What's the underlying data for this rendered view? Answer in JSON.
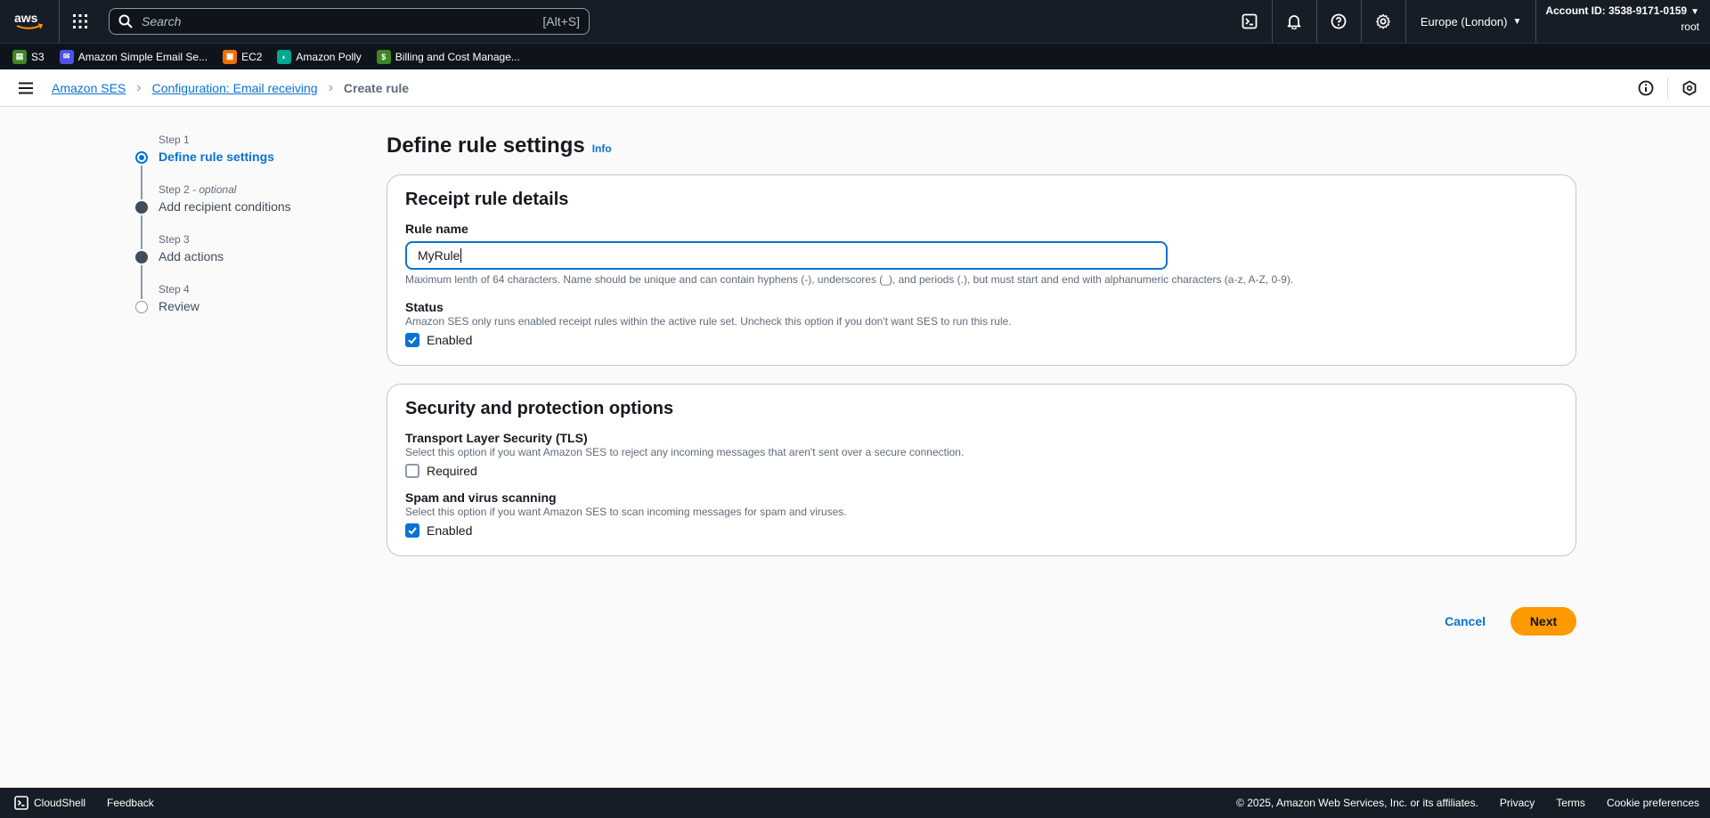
{
  "topnav": {
    "logo_text": "aws",
    "search_placeholder": "Search",
    "search_shortcut": "[Alt+S]",
    "region": "Europe (London)",
    "account_id": "Account ID: 3538-9171-0159",
    "user": "root"
  },
  "favorites": [
    {
      "label": "S3",
      "color": "#3f8624",
      "icon": "s3-icon"
    },
    {
      "label": "Amazon Simple Email Se...",
      "color": "#4d52e6",
      "icon": "ses-icon"
    },
    {
      "label": "EC2",
      "color": "#ed7100",
      "icon": "ec2-icon"
    },
    {
      "label": "Amazon Polly",
      "color": "#01a88d",
      "icon": "polly-icon"
    },
    {
      "label": "Billing and Cost Manage...",
      "color": "#3f8624",
      "icon": "billing-icon"
    }
  ],
  "breadcrumb": {
    "items": [
      "Amazon SES",
      "Configuration: Email receiving"
    ],
    "current": "Create rule"
  },
  "steps": [
    {
      "num": "Step 1",
      "optional": "",
      "label": "Define rule settings",
      "state": "active"
    },
    {
      "num": "Step 2",
      "optional": " - optional",
      "label": "Add recipient conditions",
      "state": "done"
    },
    {
      "num": "Step 3",
      "optional": "",
      "label": "Add actions",
      "state": "done"
    },
    {
      "num": "Step 4",
      "optional": "",
      "label": "Review",
      "state": "pending"
    }
  ],
  "page": {
    "title": "Define rule settings",
    "info_link": "Info"
  },
  "receipt_card": {
    "title": "Receipt rule details",
    "rule_name_label": "Rule name",
    "rule_name_value": "MyRule",
    "rule_name_hint": "Maximum lenth of 64 characters. Name should be unique and can contain hyphens (-), underscores (_), and periods (.), but must start and end with alphanumeric characters (a-z, A-Z, 0-9).",
    "status_label": "Status",
    "status_desc": "Amazon SES only runs enabled receipt rules within the active rule set. Uncheck this option if you don't want SES to run this rule.",
    "status_check_label": "Enabled",
    "status_checked": true
  },
  "security_card": {
    "title": "Security and protection options",
    "tls_label": "Transport Layer Security (TLS)",
    "tls_desc": "Select this option if you want Amazon SES to reject any incoming messages that aren't sent over a secure connection.",
    "tls_check_label": "Required",
    "tls_checked": false,
    "spam_label": "Spam and virus scanning",
    "spam_desc": "Select this option if you want Amazon SES to scan incoming messages for spam and viruses.",
    "spam_check_label": "Enabled",
    "spam_checked": true
  },
  "actions": {
    "cancel": "Cancel",
    "next": "Next"
  },
  "footer": {
    "cloudshell": "CloudShell",
    "feedback": "Feedback",
    "copyright": "© 2025, Amazon Web Services, Inc. or its affiliates.",
    "privacy": "Privacy",
    "terms": "Terms",
    "cookies": "Cookie preferences"
  },
  "colors": {
    "accent": "#0972d3",
    "primary_button": "#ff9900",
    "nav_bg": "#161d26"
  }
}
